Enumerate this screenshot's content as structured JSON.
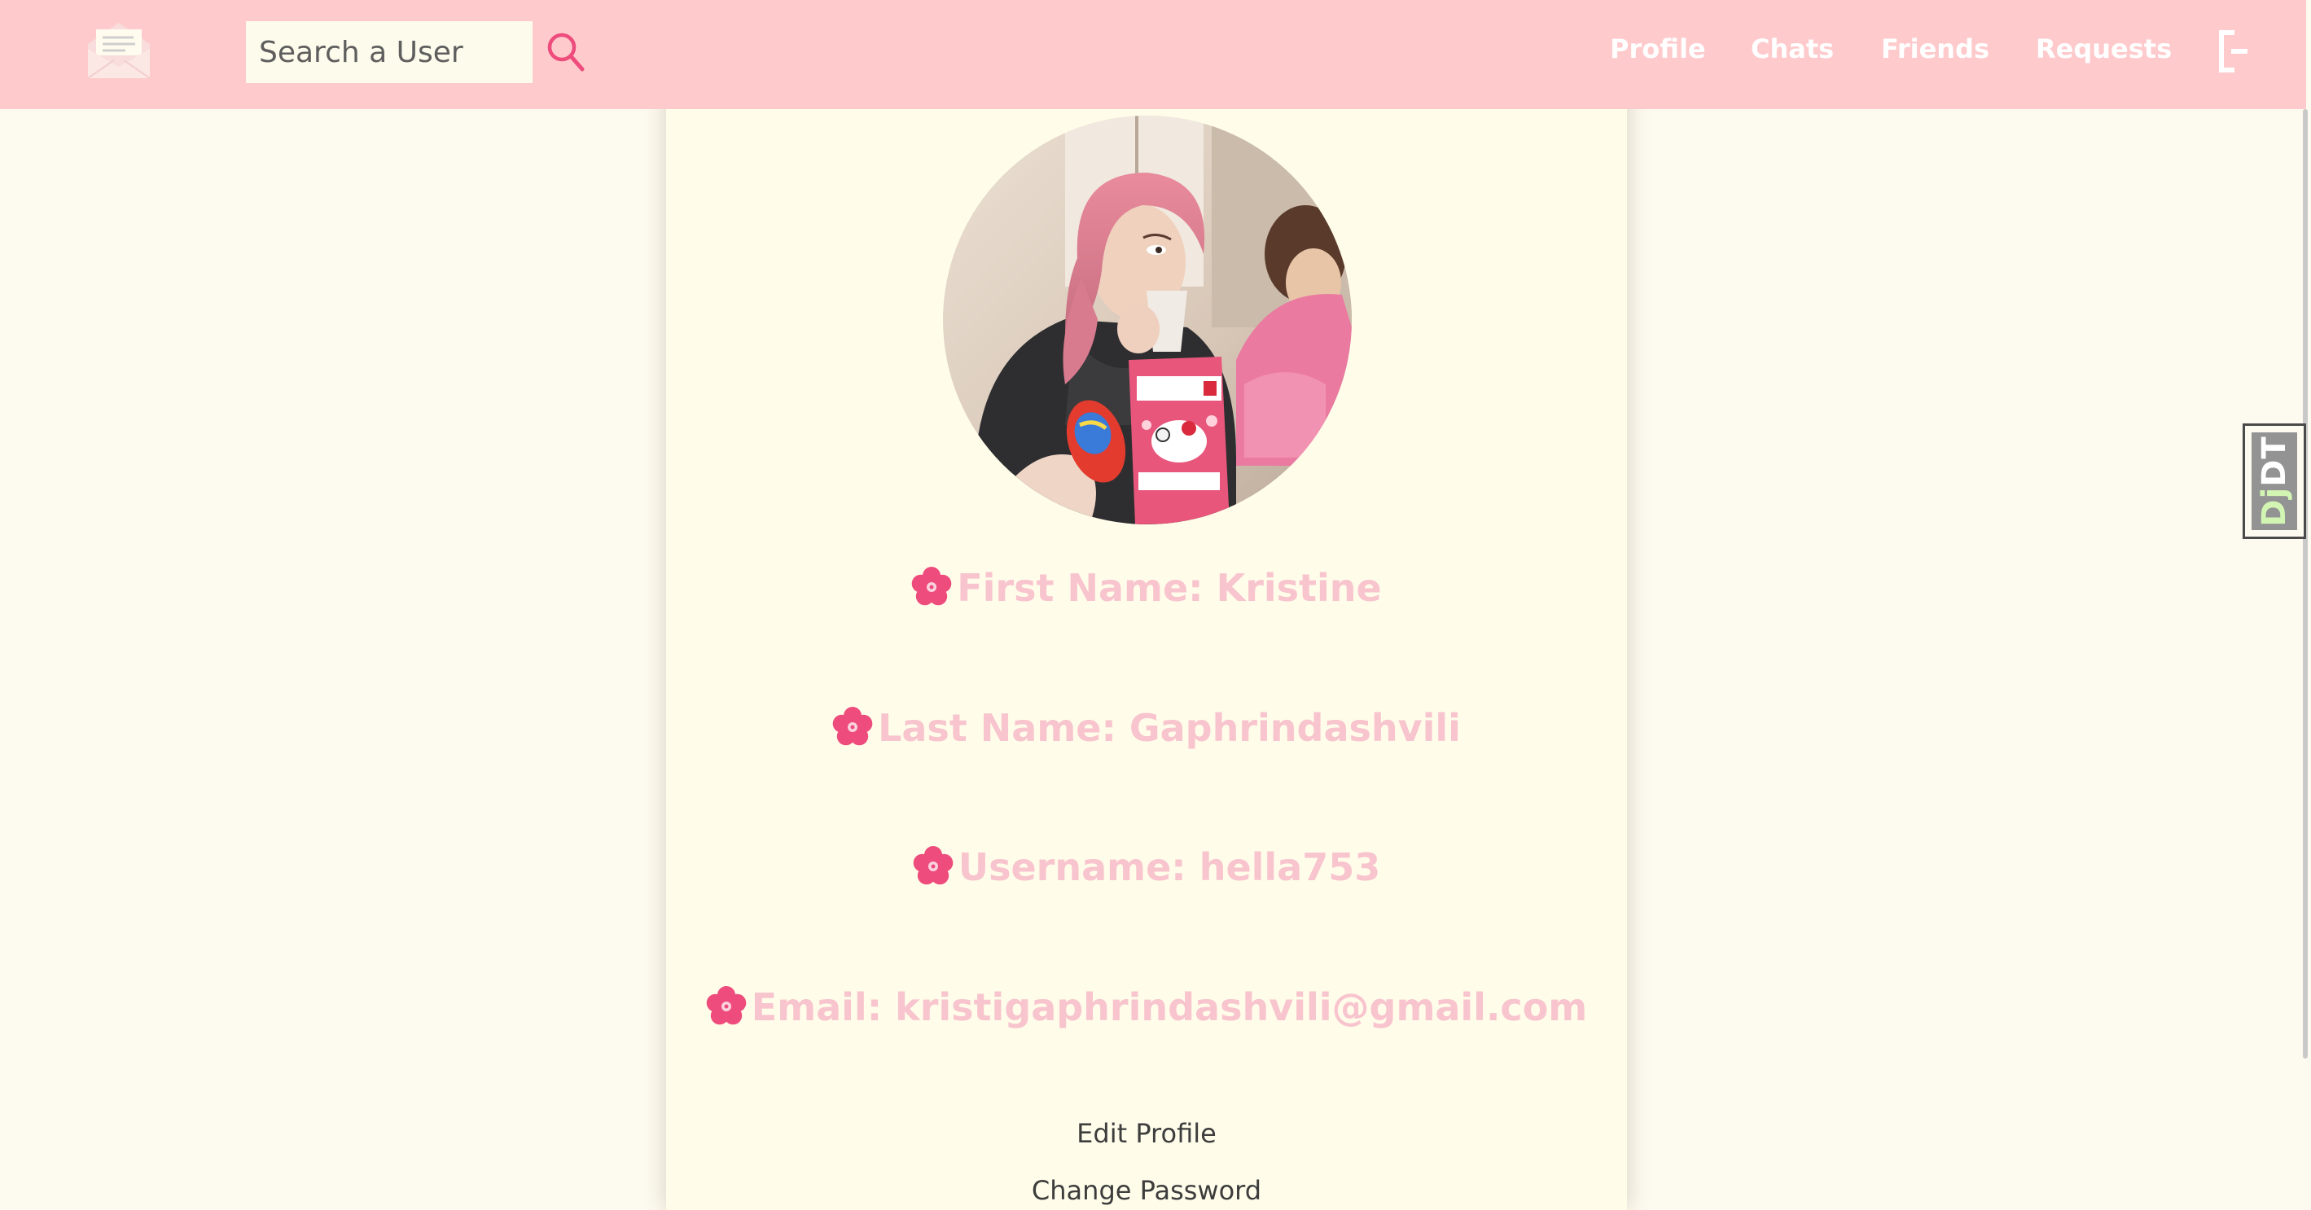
{
  "search": {
    "placeholder": "Search a User"
  },
  "nav": {
    "links": [
      {
        "label": "Profile"
      },
      {
        "label": "Chats"
      },
      {
        "label": "Friends"
      },
      {
        "label": "Requests"
      }
    ]
  },
  "profile": {
    "first_name": "First Name: Kristine",
    "last_name": "Last Name: Gaphrindashvili",
    "username": "Username: hella753",
    "email": "Email: kristigaphrindashvili@gmail.com",
    "edit_profile": "Edit Profile",
    "change_password": "Change Password"
  },
  "debug_toolbar": {
    "dj": "Dj",
    "dt": "DT"
  },
  "colors": {
    "navbar_bg": "#fecacc",
    "page_bg": "#fdfaef",
    "card_bg": "#fffdea",
    "info_text": "#f8c4ce",
    "accent_pink": "#ee4c7c",
    "nav_text": "#ffffff"
  },
  "icons": {
    "logo": "envelope-logo-icon",
    "search": "magnifier-icon",
    "logout": "logout-icon",
    "info_bullet": "cherry-blossom-icon"
  }
}
